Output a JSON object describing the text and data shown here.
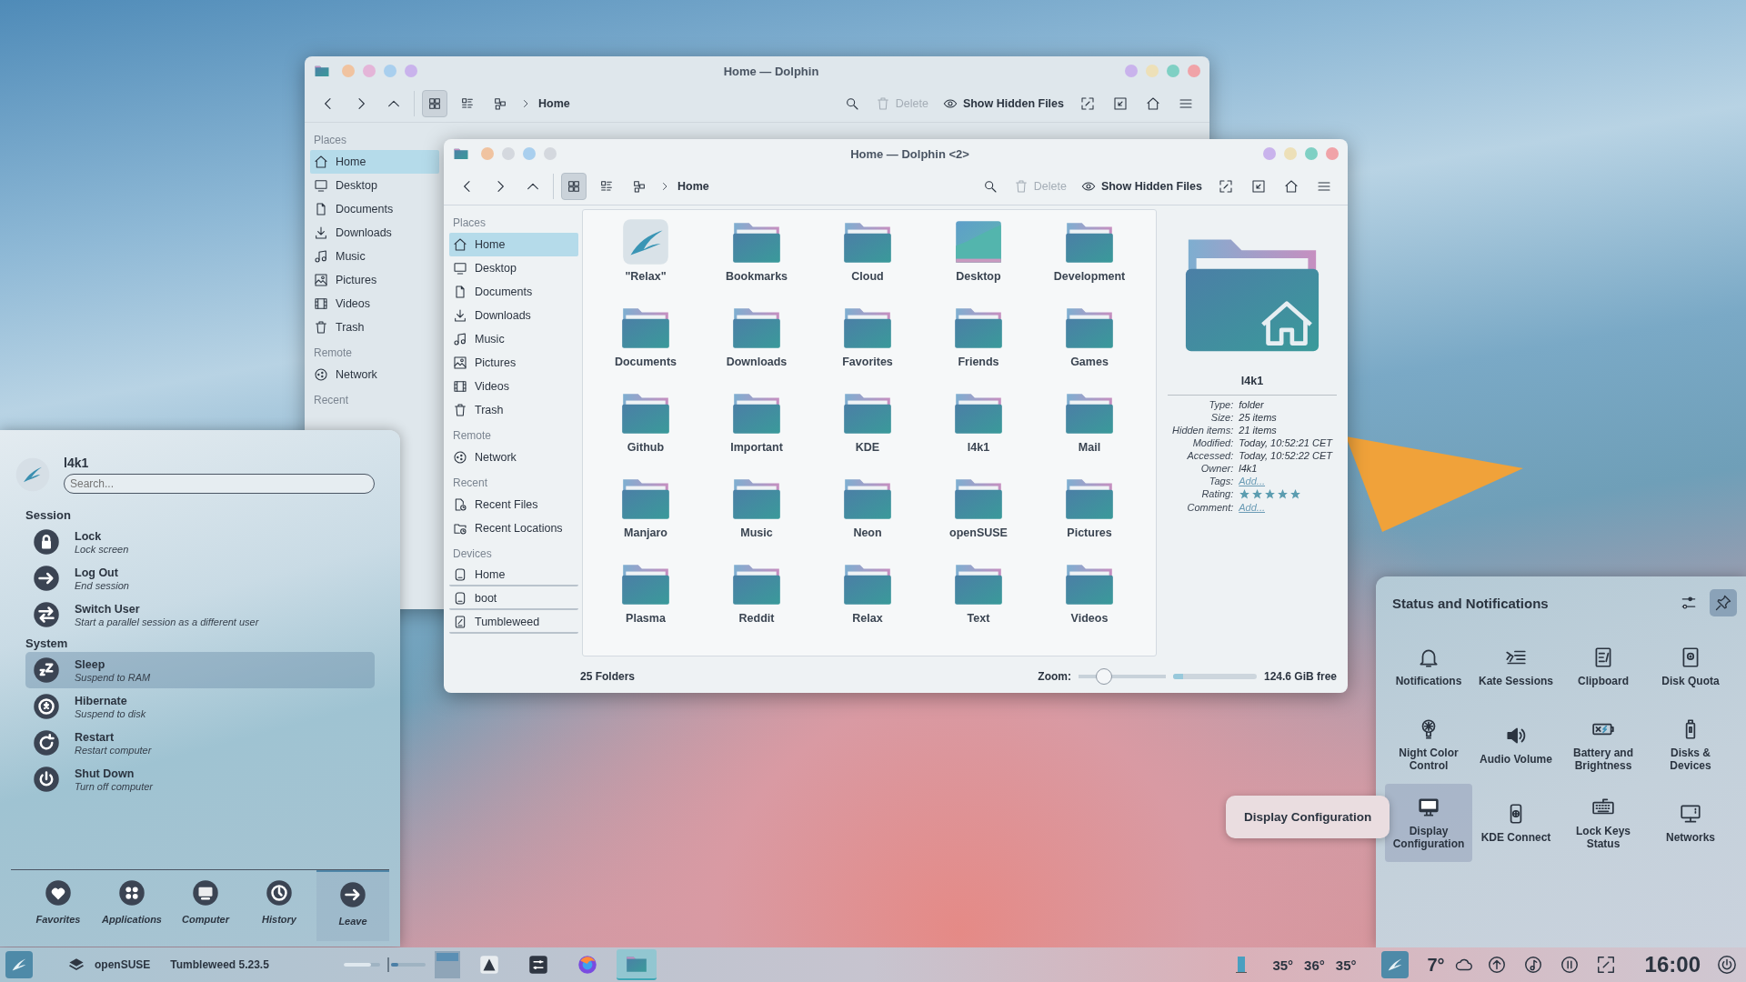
{
  "back_window": {
    "title": "Home — Dolphin",
    "toolbar": {
      "view_modes": [
        {
          "kind": "icons",
          "selected": true
        },
        {
          "kind": "details",
          "selected": false
        },
        {
          "kind": "compact",
          "selected": false
        }
      ],
      "breadcrumb": "Home",
      "delete": {
        "label": "Delete",
        "disabled": true
      },
      "hidden_files": {
        "label": "Show Hidden Files"
      }
    },
    "sidebar": [
      {
        "heading": "Places",
        "items": [
          {
            "label": "Home",
            "kind": "home",
            "selected": true
          },
          {
            "label": "Desktop",
            "kind": "desktop",
            "selected": false
          },
          {
            "label": "Documents",
            "kind": "documents",
            "selected": false
          },
          {
            "label": "Downloads",
            "kind": "downloads",
            "selected": false
          },
          {
            "label": "Music",
            "kind": "music",
            "selected": false
          },
          {
            "label": "Pictures",
            "kind": "pictures",
            "selected": false
          },
          {
            "label": "Videos",
            "kind": "videos",
            "selected": false
          },
          {
            "label": "Trash",
            "kind": "trash",
            "selected": false
          }
        ]
      },
      {
        "heading": "Remote",
        "items": [
          {
            "label": "Network",
            "kind": "network",
            "selected": false
          }
        ]
      },
      {
        "heading": "Recent"
      }
    ]
  },
  "front_window": {
    "title": "Home — Dolphin <2>",
    "toolbar": {
      "view_modes": [
        {
          "kind": "icons",
          "selected": true
        },
        {
          "kind": "details",
          "selected": false
        },
        {
          "kind": "compact",
          "selected": false
        }
      ],
      "breadcrumb": "Home",
      "delete": {
        "label": "Delete",
        "disabled": true
      },
      "hidden_files": {
        "label": "Show Hidden Files"
      }
    },
    "sidebar": [
      {
        "heading": "Places",
        "items": [
          {
            "label": "Home",
            "kind": "home",
            "selected": true
          },
          {
            "label": "Desktop",
            "kind": "desktop",
            "selected": false
          },
          {
            "label": "Documents",
            "kind": "documents",
            "selected": false
          },
          {
            "label": "Downloads",
            "kind": "downloads",
            "selected": false
          },
          {
            "label": "Music",
            "kind": "music",
            "selected": false
          },
          {
            "label": "Pictures",
            "kind": "pictures",
            "selected": false
          },
          {
            "label": "Videos",
            "kind": "videos",
            "selected": false
          },
          {
            "label": "Trash",
            "kind": "trash",
            "selected": false
          }
        ]
      },
      {
        "heading": "Remote",
        "items": [
          {
            "label": "Network",
            "kind": "network",
            "selected": false
          }
        ]
      },
      {
        "heading": "Recent",
        "items": [
          {
            "label": "Recent Files",
            "kind": "recent_files",
            "selected": false
          },
          {
            "label": "Recent Locations",
            "kind": "recent_locations",
            "selected": false
          }
        ]
      },
      {
        "heading": "Devices",
        "items": [
          {
            "label": "Home",
            "kind": "drive",
            "selected": false
          },
          {
            "label": "boot",
            "kind": "drive",
            "selected": false
          },
          {
            "label": "Tumbleweed",
            "kind": "system_drive",
            "selected": false
          }
        ]
      }
    ],
    "files": [
      {
        "name": "\"Relax\"",
        "kind": "launcher"
      },
      {
        "name": "Bookmarks",
        "kind": "folder"
      },
      {
        "name": "Cloud",
        "kind": "folder"
      },
      {
        "name": "Desktop",
        "kind": "wallpaper"
      },
      {
        "name": "Development",
        "kind": "folder"
      },
      {
        "name": "Documents",
        "kind": "folder"
      },
      {
        "name": "Downloads",
        "kind": "folder"
      },
      {
        "name": "Favorites",
        "kind": "folder"
      },
      {
        "name": "Friends",
        "kind": "folder"
      },
      {
        "name": "Games",
        "kind": "folder"
      },
      {
        "name": "Github",
        "kind": "folder"
      },
      {
        "name": "Important",
        "kind": "folder"
      },
      {
        "name": "KDE",
        "kind": "folder"
      },
      {
        "name": "l4k1",
        "kind": "folder"
      },
      {
        "name": "Mail",
        "kind": "folder"
      },
      {
        "name": "Manjaro",
        "kind": "folder"
      },
      {
        "name": "Music",
        "kind": "folder"
      },
      {
        "name": "Neon",
        "kind": "folder"
      },
      {
        "name": "openSUSE",
        "kind": "folder"
      },
      {
        "name": "Pictures",
        "kind": "folder"
      },
      {
        "name": "Plasma",
        "kind": "folder"
      },
      {
        "name": "Reddit",
        "kind": "folder"
      },
      {
        "name": "Relax",
        "kind": "folder"
      },
      {
        "name": "Text",
        "kind": "folder"
      },
      {
        "name": "Videos",
        "kind": "folder"
      }
    ],
    "info": {
      "name": "l4k1",
      "fields": [
        {
          "label": "Type:",
          "value": "folder",
          "kind": "text"
        },
        {
          "label": "Size:",
          "value": "25 items",
          "kind": "text"
        },
        {
          "label": "Hidden items:",
          "value": "21 items",
          "kind": "text"
        },
        {
          "label": "Modified:",
          "value": "Today, 10:52:21 CET",
          "kind": "text"
        },
        {
          "label": "Accessed:",
          "value": "Today, 10:52:22 CET",
          "kind": "text"
        },
        {
          "label": "Owner:",
          "value": "l4k1",
          "kind": "text"
        },
        {
          "label": "Tags:",
          "value": "Add...",
          "kind": "link"
        },
        {
          "label": "Rating:",
          "stars": 5,
          "kind": "rating"
        },
        {
          "label": "Comment:",
          "value": "Add...",
          "kind": "link"
        }
      ]
    },
    "status_bar": {
      "count": "25 Folders",
      "zoom_label": "Zoom:",
      "zoom": {
        "level": 0.28
      },
      "free_space": {
        "level": 0.12,
        "text": "124.6 GiB free"
      }
    }
  },
  "start_menu": {
    "user": "l4k1",
    "search": {
      "placeholder": "Search..."
    },
    "sections": [
      {
        "heading": "Session",
        "items": [
          {
            "title": "Lock",
            "subtitle": "Lock screen",
            "kind": "lock",
            "selected": false
          },
          {
            "title": "Log Out",
            "subtitle": "End session",
            "kind": "logout",
            "selected": false
          },
          {
            "title": "Switch User",
            "subtitle": "Start a parallel session as a different user",
            "kind": "switch",
            "selected": false
          }
        ]
      },
      {
        "heading": "System",
        "items": [
          {
            "title": "Sleep",
            "subtitle": "Suspend to RAM",
            "kind": "sleep",
            "selected": true
          },
          {
            "title": "Hibernate",
            "subtitle": "Suspend to disk",
            "kind": "hibernate",
            "selected": false
          },
          {
            "title": "Restart",
            "subtitle": "Restart computer",
            "kind": "restart",
            "selected": false
          },
          {
            "title": "Shut Down",
            "subtitle": "Turn off computer",
            "kind": "shutdown",
            "selected": false
          }
        ]
      }
    ],
    "tabs": [
      {
        "label": "Favorites",
        "kind": "favorites",
        "selected": false
      },
      {
        "label": "Applications",
        "kind": "applications",
        "selected": false
      },
      {
        "label": "Computer",
        "kind": "computer",
        "selected": false
      },
      {
        "label": "History",
        "kind": "history",
        "selected": false
      },
      {
        "label": "Leave",
        "kind": "leave",
        "selected": true
      }
    ]
  },
  "status_panel": {
    "title": "Status and Notifications",
    "pinned": true,
    "items": [
      {
        "label": "Notifications",
        "kind": "bell",
        "selected": false
      },
      {
        "label": "Kate Sessions",
        "kind": "kate",
        "selected": false
      },
      {
        "label": "Clipboard",
        "kind": "clipboard",
        "selected": false
      },
      {
        "label": "Disk Quota",
        "kind": "disk",
        "selected": false
      },
      {
        "label": "Night Color Control",
        "kind": "bulb",
        "selected": false
      },
      {
        "label": "Audio Volume",
        "kind": "speaker",
        "selected": false
      },
      {
        "label": "Battery and Brightness",
        "kind": "battery",
        "selected": false
      },
      {
        "label": "Disks & Devices",
        "kind": "usb",
        "selected": false
      },
      {
        "label": "Display Configuration",
        "kind": "monitor",
        "selected": true
      },
      {
        "label": "KDE Connect",
        "kind": "phone",
        "selected": false
      },
      {
        "label": "Lock Keys Status",
        "kind": "keyboard",
        "selected": false
      },
      {
        "label": "Networks",
        "kind": "network_monitor",
        "selected": false
      }
    ],
    "tooltip": "Display Configuration"
  },
  "taskbar": {
    "distro": "openSUSE",
    "version": "Tumbleweed 5.23.5",
    "tasks": [
      {
        "kind": "drawing",
        "active": false
      },
      {
        "kind": "settings",
        "active": false
      },
      {
        "kind": "browser",
        "active": false
      },
      {
        "kind": "files",
        "active": true
      }
    ],
    "temperatures": [
      "35°",
      "36°",
      "35°"
    ],
    "weather": "7°",
    "tray": [
      {
        "kind": "updates"
      },
      {
        "kind": "audio"
      },
      {
        "kind": "media"
      },
      {
        "kind": "expand"
      }
    ],
    "clock": "16:00"
  }
}
